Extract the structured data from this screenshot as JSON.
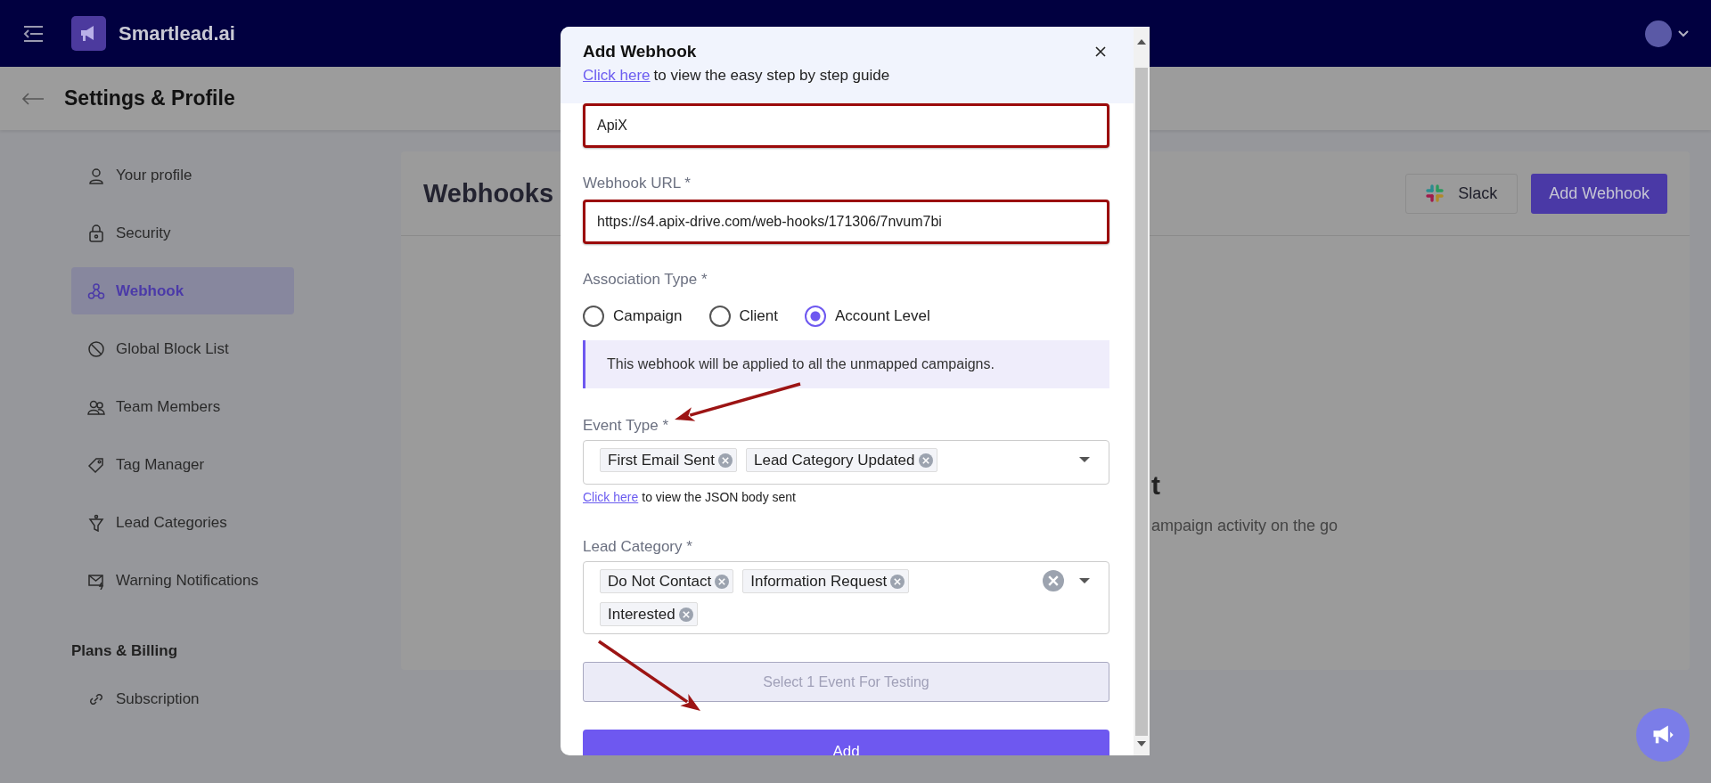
{
  "top_bar": {
    "logo_text": "Smartlead.ai"
  },
  "page_header": {
    "title": "Settings & Profile"
  },
  "sidebar": {
    "items": [
      {
        "label": "Your profile",
        "selected": false
      },
      {
        "label": "Security",
        "selected": false
      },
      {
        "label": "Webhook",
        "selected": true
      },
      {
        "label": "Global Block List",
        "selected": false
      },
      {
        "label": "Team Members",
        "selected": false
      },
      {
        "label": "Tag Manager",
        "selected": false
      },
      {
        "label": "Lead Categories",
        "selected": false
      },
      {
        "label": "Warning Notifications",
        "selected": false
      }
    ],
    "section_title": "Plans & Billing",
    "section_items": [
      {
        "label": "Subscription",
        "selected": false
      }
    ]
  },
  "card": {
    "title": "Webhooks",
    "buttons": [
      {
        "label": "Slack",
        "kind": "slack"
      },
      {
        "label": "Add Webhook",
        "kind": "primary"
      }
    ],
    "empty_heading": "t",
    "empty_text": "ampaign activity on the go"
  },
  "modal": {
    "title": "Add Webhook",
    "guide_link": "Click here",
    "guide_text": "to view the easy step by step guide",
    "name_field": {
      "value": "ApiX",
      "highlighted": true
    },
    "url_field": {
      "label": "Webhook URL *",
      "value": "https://s4.apix-drive.com/web-hooks/171306/7nvum7bi",
      "highlighted": true
    },
    "association": {
      "label": "Association Type *",
      "options": [
        {
          "label": "Campaign",
          "selected": false
        },
        {
          "label": "Client",
          "selected": false
        },
        {
          "label": "Account Level",
          "selected": true
        }
      ],
      "info": "This webhook will be applied to all the unmapped campaigns."
    },
    "event_type": {
      "label": "Event Type *",
      "tags": [
        "First Email Sent",
        "Lead Category Updated"
      ],
      "clearable": false
    },
    "json_link": "Click here",
    "json_text": "to view the JSON body sent",
    "lead_category": {
      "label": "Lead Category *",
      "tags": [
        "Do Not Contact",
        "Information Request",
        "Interested"
      ],
      "clearable": true
    },
    "test_button": {
      "label": "Select 1 Event For Testing",
      "disabled": true
    },
    "add_button": {
      "label": "Add"
    }
  }
}
